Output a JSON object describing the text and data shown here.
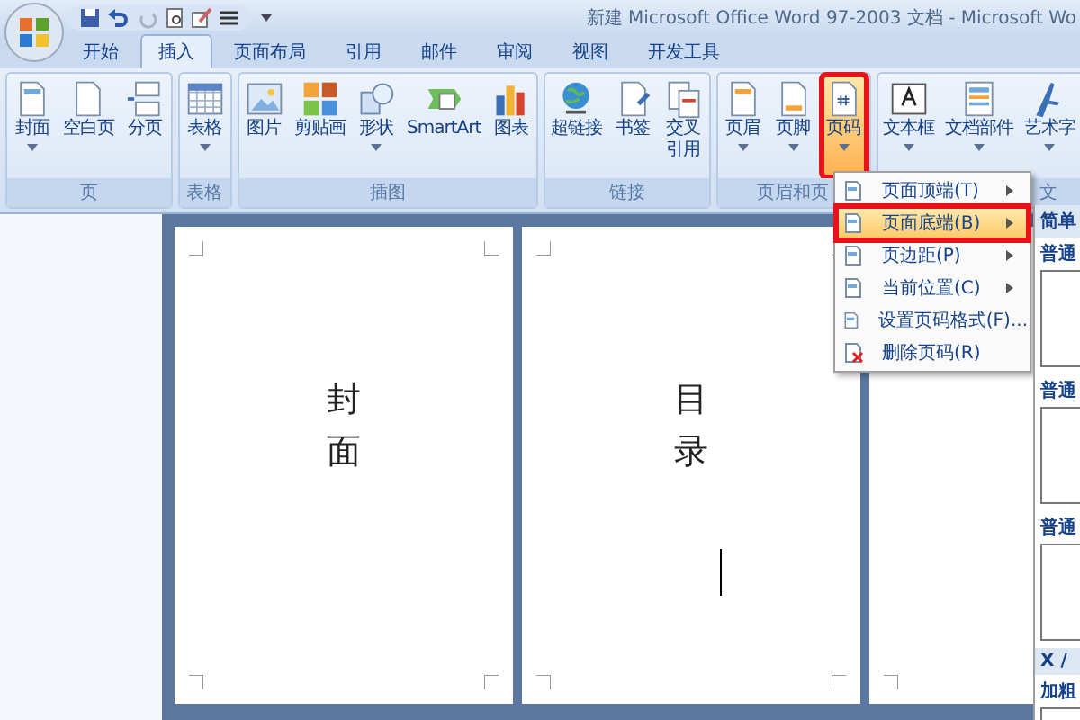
{
  "window": {
    "title": "新建 Microsoft Office Word 97-2003 文档 - Microsoft Wo"
  },
  "tabs": [
    {
      "label": "开始",
      "selected": false
    },
    {
      "label": "插入",
      "selected": true
    },
    {
      "label": "页面布局",
      "selected": false
    },
    {
      "label": "引用",
      "selected": false
    },
    {
      "label": "邮件",
      "selected": false
    },
    {
      "label": "审阅",
      "selected": false
    },
    {
      "label": "视图",
      "selected": false
    },
    {
      "label": "开发工具",
      "selected": false
    }
  ],
  "ribbon_groups": [
    {
      "label": "页",
      "buttons": [
        {
          "label": "封面",
          "dropdown": true,
          "selected": false,
          "highlighted": false
        },
        {
          "label": "空白页",
          "dropdown": false,
          "selected": false,
          "highlighted": false
        },
        {
          "label": "分页",
          "dropdown": false,
          "selected": false,
          "highlighted": false
        }
      ]
    },
    {
      "label": "表格",
      "buttons": [
        {
          "label": "表格",
          "dropdown": true,
          "selected": false,
          "highlighted": false
        }
      ]
    },
    {
      "label": "插图",
      "buttons": [
        {
          "label": "图片",
          "dropdown": false,
          "selected": false,
          "highlighted": false
        },
        {
          "label": "剪贴画",
          "dropdown": false,
          "selected": false,
          "highlighted": false
        },
        {
          "label": "形状",
          "dropdown": true,
          "selected": false,
          "highlighted": false
        },
        {
          "label": "SmartArt",
          "dropdown": false,
          "selected": false,
          "highlighted": false
        },
        {
          "label": "图表",
          "dropdown": false,
          "selected": false,
          "highlighted": false
        }
      ]
    },
    {
      "label": "链接",
      "buttons": [
        {
          "label": "超链接",
          "dropdown": false,
          "selected": false,
          "highlighted": false
        },
        {
          "label": "书签",
          "dropdown": false,
          "selected": false,
          "highlighted": false
        },
        {
          "label": "交叉引用",
          "wrap": true,
          "dropdown": false,
          "selected": false,
          "highlighted": false
        }
      ]
    },
    {
      "label": "页眉和页",
      "buttons": [
        {
          "label": "页眉",
          "dropdown": true,
          "selected": false,
          "highlighted": false
        },
        {
          "label": "页脚",
          "dropdown": true,
          "selected": false,
          "highlighted": false
        },
        {
          "label": "页码",
          "dropdown": true,
          "selected": true,
          "highlighted": true
        }
      ]
    },
    {
      "label": "文",
      "buttons": [
        {
          "label": "文本框",
          "dropdown": true,
          "selected": false,
          "highlighted": false
        },
        {
          "label": "文档部件",
          "dropdown": true,
          "selected": false,
          "highlighted": false
        },
        {
          "label": "艺术字",
          "dropdown": true,
          "selected": false,
          "highlighted": false
        }
      ]
    }
  ],
  "pages": [
    {
      "text": "封面",
      "cursor": false
    },
    {
      "text": "目录",
      "cursor": true
    }
  ],
  "page_number_menu": [
    {
      "label": "页面顶端(T)",
      "submenu": true,
      "selected": false,
      "highlighted": false
    },
    {
      "label": "页面底端(B)",
      "submenu": true,
      "selected": true,
      "highlighted": true
    },
    {
      "label": "页边距(P)",
      "submenu": true,
      "selected": false,
      "highlighted": false
    },
    {
      "label": "当前位置(C)",
      "submenu": true,
      "selected": false,
      "highlighted": false
    },
    {
      "label": "设置页码格式(F)...",
      "submenu": false,
      "selected": false,
      "highlighted": false
    },
    {
      "label": "删除页码(R)",
      "submenu": false,
      "selected": false,
      "highlighted": false
    }
  ],
  "gallery": [
    {
      "kind": "heading",
      "label": "简单"
    },
    {
      "kind": "item",
      "label": "普通"
    },
    {
      "kind": "item",
      "label": "普通"
    },
    {
      "kind": "item",
      "label": "普通"
    },
    {
      "kind": "heading",
      "label": "X /"
    },
    {
      "kind": "item",
      "label": "加粗"
    }
  ]
}
